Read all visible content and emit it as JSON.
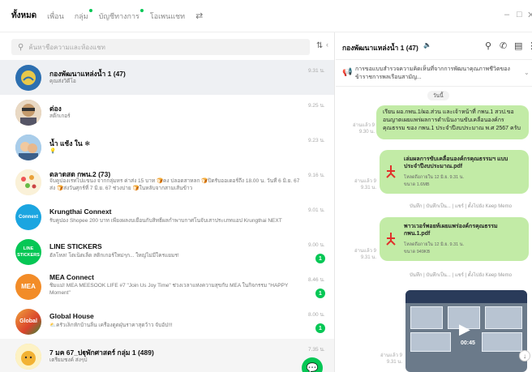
{
  "tabs": [
    {
      "label": "ทั้งหมด",
      "active": true
    },
    {
      "label": "เพื่อน"
    },
    {
      "label": "กลุ่ม",
      "dot": true
    },
    {
      "label": "บัญชีทางการ",
      "dot": true
    },
    {
      "label": "โอเพนแชท"
    }
  ],
  "search": {
    "placeholder": "ค้นหาชื่อความและห้องแชท"
  },
  "chats": [
    {
      "name": "กองพัฒนาแหล่งน้ำ 1 (47)",
      "preview": "คุณส่งวิดีโอ",
      "time": "9.31 น.",
      "selected": true,
      "avatar_color": "#2c6fb0"
    },
    {
      "name": "ต่อง",
      "preview": "สติ๊กเกอร์",
      "time": "9.25 น.",
      "avatar_color": "#c49a6c"
    },
    {
      "name": "น้ำ แช้ง ใน ❄",
      "preview": "💡",
      "time": "9.23 น.",
      "avatar_color": "#6ea6d8"
    },
    {
      "name": "ตลาดสด กพน.2 (73)",
      "preview": "จับคูปองเรทไปแขนง จากกลุ่มหร ค่าส่ง 15 บาท 🍞คง ปลอดสาหลก 🍞ปิดรับออเดอร์ถึง 18.00 น. วันที่ 6 มิ.ย. 67 ส่ง 🍞ส่งวันศุกร์ที่ 7 มิ.ย. 67 ช่วงบ่าย 🍞ในหลับจากสามเส้นข้าว",
      "time": "9.16 น.",
      "avatar_color": "#f5e6c0"
    },
    {
      "name": "Krungthai Connext",
      "preview": "รับคูปอง Shopee 200 บาท เพียงผลงบเยื่อนกับสิทธิ์ผลกำพาบกาศโนจับเสาประเภทแอป Krungthai NEXT",
      "time": "9.01 น.",
      "avatar_color": "#1ba5e0",
      "avatar_text": "Connext"
    },
    {
      "name": "LINE STICKERS",
      "preview": "ฮัลโหล! โตเน็ตเลิ้ด สติกเกอร์ใหม่ๆก... ใหญ่ไม่มีใครแยมร!",
      "time": "9.00 น.",
      "badge": "1",
      "avatar_color": "#06c755",
      "avatar_text": "LINE STICKERS"
    },
    {
      "name": "MEA Connect",
      "preview": "ชิมแม่! MEA MEESOOK LIFE #7 \"Join Us Joy Time\" ช่วงเวลาแห่งความสุขกับ MEA ในกิจกรรม \"HAPPY Moment\"",
      "time": "8.46 น.",
      "badge": "1",
      "avatar_color": "#f28c28",
      "avatar_text": "MEA"
    },
    {
      "name": "Global House",
      "preview": "⛅ครัวเล็กหักบ้านลิ้น เครื่องดูดฝุ่นราคาสุดว้าว จับอัป!!!",
      "time": "8.00 น.",
      "badge": "1",
      "avatar_color": "#2e8b3a",
      "avatar_text": "Global"
    },
    {
      "name": "7 มค 67_ปฐุพักศาสตร์ กลุ่ม 1 (489)",
      "preview": "เตรียมชงค์ ส่งๆป",
      "time": "7.35 น.",
      "avatar_color": "#f7d060"
    }
  ],
  "conversation": {
    "title": "กองพัฒนาแหล่งน้ำ 1 (47)",
    "announcement": "การขอแบบสำรวจความคิดเห็นที่จากการพัฒนาคุณภาพชีวิตของข้าราชการพลเรือนสามัญ...",
    "date_label": "วันนี้",
    "messages": [
      {
        "kind": "text",
        "text": "เรียน ผอ.กพน.1/ผอ.ส่วน และเจ้าหน้าที่ กพน.1 สวป.ขออนญาตเผยแพร่ผลการดำเนินงานขับเคลื่อนองค์กรคุณธรรม ของ กพน.1 ประจำปีงบประมาณ พ.ศ 2567 ครับ",
        "time": "อ่านแล้ว 9\n9.30 น."
      },
      {
        "kind": "file",
        "name": "เล่มผลการขับเคลื่อนองค์กรคุณธรรมฯ แบบประจำปีงบประมาณ.pdf",
        "meta1": "โหลดถึงภายใน 12 มิ.ย. 9.31 น.",
        "meta2": "ขนาด 1.6MB",
        "time": "อ่านแล้ว 9\n9.31 น.",
        "actions": "บันทึก | บันทึกเป็น... | แชร์ | ตั้งไปยัง Keep Memo"
      },
      {
        "kind": "file",
        "name": "พาวเวอร์พอยท์เผยแพร่องค์กรคุณธรรม กพน.1.pdf",
        "meta1": "โหลดถึงภายใน 12 มิ.ย. 9.31 น.",
        "meta2": "ขนาด 949KB",
        "time": "อ่านแล้ว 9\n9.31 น.",
        "actions": "บันทึก | บันทึกเป็น... | แชร์ | ตั้งไปยัง Keep Memo"
      },
      {
        "kind": "video",
        "duration": "00:45",
        "time": "อ่านแล้ว 9\n9.31 น."
      }
    ]
  },
  "icons": {
    "search": "search-icon",
    "call": "phone-icon",
    "notes": "notes-icon",
    "menu": "more-icon"
  },
  "colors": {
    "accent": "#06c755",
    "bubble": "#c2eba6"
  }
}
